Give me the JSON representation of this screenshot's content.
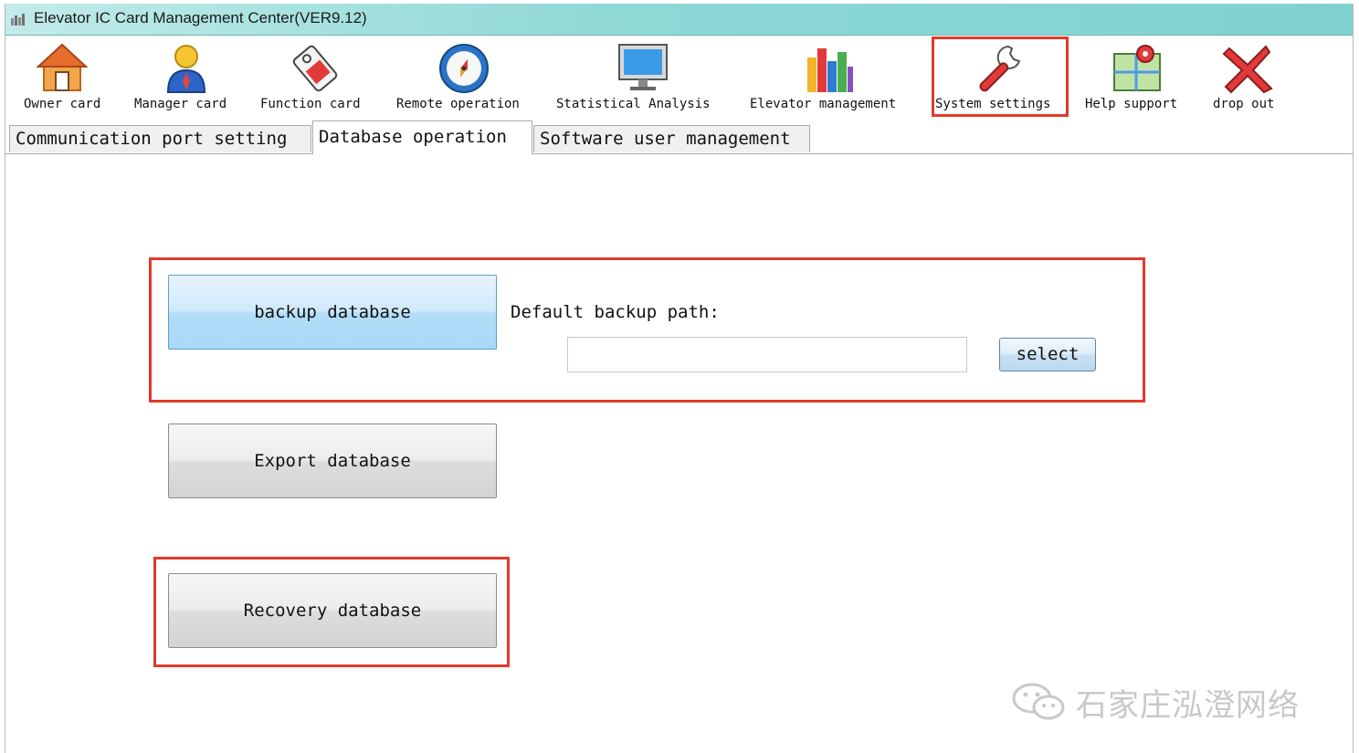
{
  "window": {
    "title": "Elevator IC Card Management Center(VER9.12)"
  },
  "toolbar": {
    "items": [
      {
        "label": "Owner card",
        "icon": "house-icon"
      },
      {
        "label": "Manager card",
        "icon": "manager-user-icon"
      },
      {
        "label": "Function card",
        "icon": "tag-card-icon"
      },
      {
        "label": "Remote operation",
        "icon": "compass-icon"
      },
      {
        "label": "Statistical Analysis",
        "icon": "monitor-icon"
      },
      {
        "label": "Elevator management",
        "icon": "building-chart-icon"
      },
      {
        "label": "System settings",
        "icon": "wrench-icon"
      },
      {
        "label": "Help support",
        "icon": "map-pin-icon"
      },
      {
        "label": "drop out",
        "icon": "red-x-icon"
      }
    ],
    "selected": "System settings"
  },
  "tabs": {
    "items": [
      {
        "label": "Communication port setting"
      },
      {
        "label": "Database operation"
      },
      {
        "label": "Software user management"
      }
    ],
    "active": "Database operation"
  },
  "database": {
    "backup_button": "backup database",
    "default_path_label": "Default backup path:",
    "path_value": "",
    "select_button": "select",
    "export_button": "Export database",
    "recovery_button": "Recovery database"
  },
  "watermark": {
    "text": "石家庄泓澄网络",
    "icon": "wechat-icon"
  },
  "colors": {
    "highlight_frame": "#e23a2a",
    "titlebar": "#8fd8d6",
    "primary_button": "#b3ddf8"
  }
}
